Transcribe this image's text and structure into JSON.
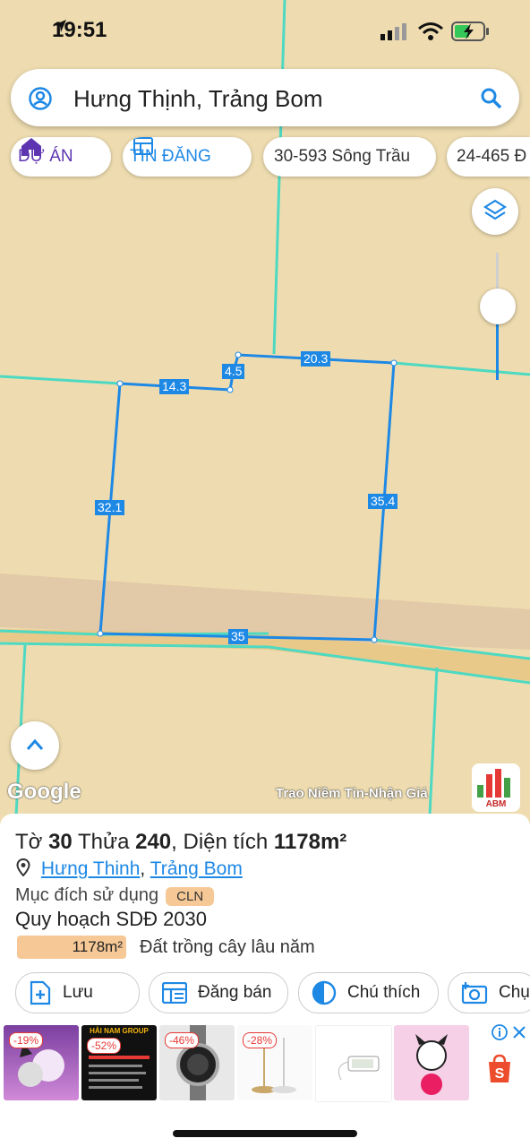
{
  "status_bar": {
    "time": "19:51"
  },
  "search": {
    "query": "Hưng Thịnh, Trảng Bom"
  },
  "chips": [
    {
      "label": "DỰ ÁN",
      "icon": "house-icon"
    },
    {
      "label": "TIN ĐĂNG",
      "icon": "listing-icon"
    },
    {
      "label": "30-593 Sông Trầu"
    },
    {
      "label": "24-465 Đ"
    }
  ],
  "map": {
    "segments": [
      {
        "name": "segment-top-left",
        "label": "14.3"
      },
      {
        "name": "segment-notch",
        "label": "4.5"
      },
      {
        "name": "segment-top-right",
        "label": "20.3"
      },
      {
        "name": "segment-left",
        "label": "32.1"
      },
      {
        "name": "segment-right",
        "label": "35.4"
      },
      {
        "name": "segment-bottom",
        "label": "35"
      }
    ],
    "attribution": "Google",
    "tagline": "Trao Niềm Tin-Nhận Giá",
    "brand_logo": "ABM"
  },
  "parcel": {
    "sheet_label": "Tờ",
    "sheet_no": "30",
    "plot_label": "Thửa",
    "plot_no": "240",
    "area_label": "Diện tích",
    "area_value": "1178m²",
    "ward": "Hưng Thinh",
    "district": "Trảng Bom",
    "purpose_label": "Mục đích sử dụng",
    "purpose_code": "CLN",
    "plan_title": "Quy hoạch SDĐ 2030",
    "plan_area": "1178m²",
    "plan_desc": "Đất trồng cây lâu năm"
  },
  "actions": [
    {
      "label": "Lưu",
      "icon": "add-doc-icon"
    },
    {
      "label": "Đăng bán",
      "icon": "post-icon"
    },
    {
      "label": "Chú thích",
      "icon": "contrast-icon"
    },
    {
      "label": "Chụ",
      "icon": "camera-icon"
    }
  ],
  "ads": [
    {
      "discount": "-19%"
    },
    {
      "discount": "-52%",
      "brand": "HẢI NAM GROUP"
    },
    {
      "discount": "-46%"
    },
    {
      "discount": "-28%"
    },
    {
      "discount": ""
    },
    {
      "discount": ""
    }
  ],
  "colors": {
    "accent": "#1e88e5",
    "parcel_line": "#1e88e5",
    "cadastral_line": "#4dd9c2",
    "map_bg": "#eedcb0",
    "road": "#e8c98a"
  }
}
